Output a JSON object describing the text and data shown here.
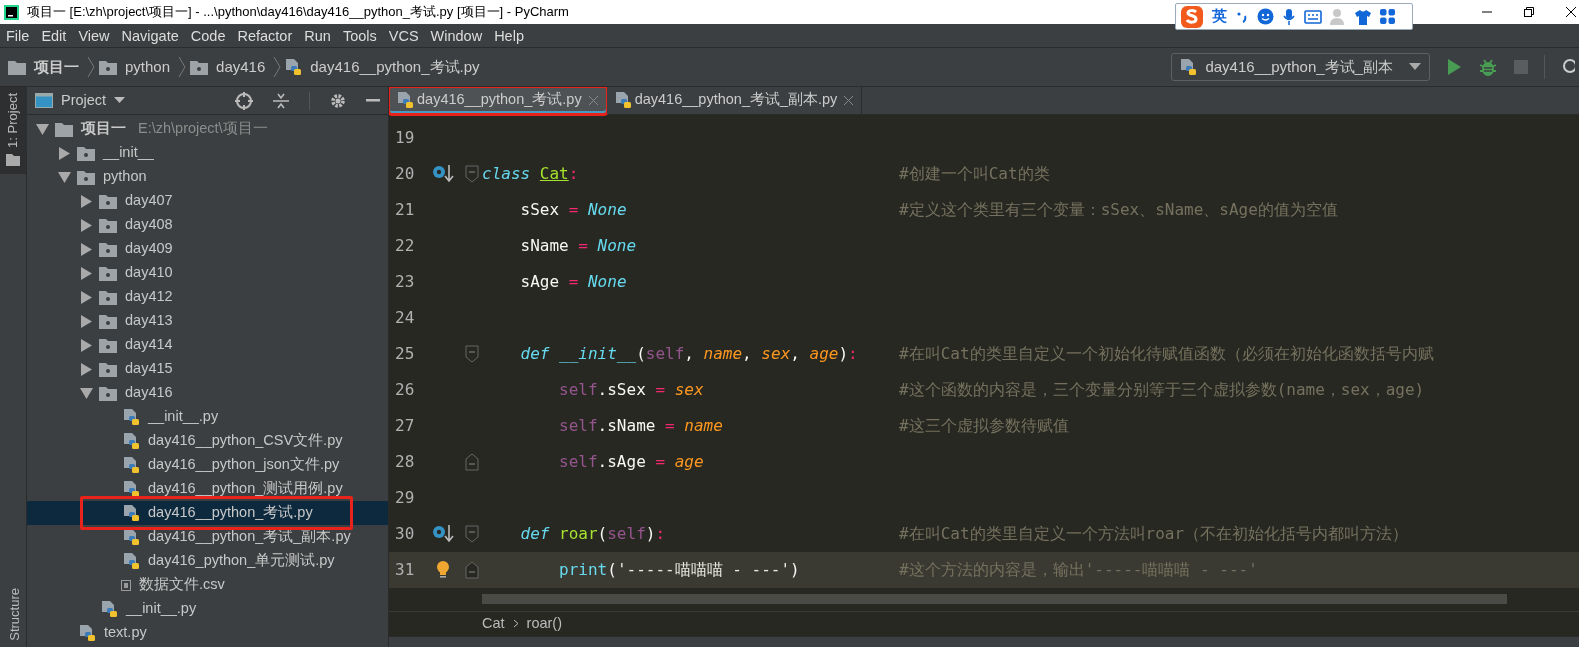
{
  "window": {
    "title": "项目一 [E:\\zh\\project\\项目一] - ...\\python\\day416\\day416__python_考试.py [项目一] - PyCharm"
  },
  "ime_toolbar": {
    "label": "英"
  },
  "menu": [
    "File",
    "Edit",
    "View",
    "Navigate",
    "Code",
    "Refactor",
    "Run",
    "Tools",
    "VCS",
    "Window",
    "Help"
  ],
  "breadcrumb": [
    {
      "label": "项目一",
      "kind": "project"
    },
    {
      "label": "python",
      "kind": "module"
    },
    {
      "label": "day416",
      "kind": "module"
    },
    {
      "label": "day416__python_考试.py",
      "kind": "pyfile"
    }
  ],
  "run_config": {
    "label": "day416__python_考试_副本"
  },
  "tool_windows": [
    {
      "label": "1: Project",
      "selected": true
    },
    {
      "label": "Structure",
      "selected": false
    }
  ],
  "project_panel": {
    "title": "Project"
  },
  "tree": [
    {
      "label": "项目一",
      "path": "E:\\zh\\project\\项目一",
      "kind": "project",
      "expanded": true,
      "selected": false,
      "children": [
        {
          "label": "__init__",
          "kind": "module",
          "expanded": false,
          "selected": false
        },
        {
          "label": "python",
          "kind": "module",
          "expanded": true,
          "selected": false,
          "children": [
            {
              "label": "day407",
              "kind": "module",
              "expanded": false,
              "selected": false
            },
            {
              "label": "day408",
              "kind": "module",
              "expanded": false,
              "selected": false
            },
            {
              "label": "day409",
              "kind": "module",
              "expanded": false,
              "selected": false
            },
            {
              "label": "day410",
              "kind": "module",
              "expanded": false,
              "selected": false
            },
            {
              "label": "day412",
              "kind": "module",
              "expanded": false,
              "selected": false
            },
            {
              "label": "day413",
              "kind": "module",
              "expanded": false,
              "selected": false
            },
            {
              "label": "day414",
              "kind": "module",
              "expanded": false,
              "selected": false
            },
            {
              "label": "day415",
              "kind": "module",
              "expanded": false,
              "selected": false
            },
            {
              "label": "day416",
              "kind": "module",
              "expanded": true,
              "selected": false,
              "children": [
                {
                  "label": "__init__.py",
                  "kind": "pyfile",
                  "selected": false
                },
                {
                  "label": "day416__python_CSV文件.py",
                  "kind": "pyfile",
                  "selected": false
                },
                {
                  "label": "day416__python_json文件.py",
                  "kind": "pyfile",
                  "selected": false
                },
                {
                  "label": "day416__python_测试用例.py",
                  "kind": "pyfile",
                  "selected": false
                },
                {
                  "label": "day416__python_考试.py",
                  "kind": "pyfile",
                  "selected": true,
                  "marked": true
                },
                {
                  "label": "day416__python_考试_副本.py",
                  "kind": "pyfile",
                  "selected": false
                },
                {
                  "label": "day416_python_单元测试.py",
                  "kind": "pyfile",
                  "selected": false
                },
                {
                  "label": "数据文件.csv",
                  "kind": "csv",
                  "selected": false
                }
              ]
            },
            {
              "label": "__init__.py",
              "kind": "pyfile",
              "selected": false
            }
          ]
        },
        {
          "label": "text.py",
          "kind": "pyfile",
          "selected": false
        }
      ]
    }
  ],
  "tabs": [
    {
      "label": "day416__python_考试.py",
      "selected": true,
      "marked": true
    },
    {
      "label": "day416__python_考试_副本.py",
      "selected": false,
      "marked": false
    }
  ],
  "code_lines": [
    {
      "number": "19",
      "current": false
    },
    {
      "number": "20",
      "current": false,
      "gutter_icon": {
        "kind": "override"
      },
      "fold": {
        "kind": "start"
      },
      "tokens": [
        {
          "text": "class ",
          "kind": "keyword"
        },
        {
          "text": "Cat",
          "kind": "classname"
        },
        {
          "text": ":",
          "kind": "operator"
        }
      ],
      "comment": "#创建一个叫Cat的类"
    },
    {
      "number": "21",
      "current": false,
      "tokens": [
        {
          "text": "    sSex ",
          "kind": "plain"
        },
        {
          "text": "=",
          "kind": "operator"
        },
        {
          "text": " None",
          "kind": "constant"
        }
      ],
      "comment": "#定义这个类里有三个变量：sSex、sName、sAge的值为空值"
    },
    {
      "number": "22",
      "current": false,
      "tokens": [
        {
          "text": "    sName ",
          "kind": "plain"
        },
        {
          "text": "=",
          "kind": "operator"
        },
        {
          "text": " None",
          "kind": "constant"
        }
      ]
    },
    {
      "number": "23",
      "current": false,
      "tokens": [
        {
          "text": "    sAge ",
          "kind": "plain"
        },
        {
          "text": "=",
          "kind": "operator"
        },
        {
          "text": " None",
          "kind": "constant"
        }
      ]
    },
    {
      "number": "24",
      "current": false
    },
    {
      "number": "25",
      "current": false,
      "fold": {
        "kind": "start"
      },
      "tokens": [
        {
          "text": "    def ",
          "kind": "keyword"
        },
        {
          "text": "__init__",
          "kind": "special"
        },
        {
          "text": "(",
          "kind": "plain"
        },
        {
          "text": "self",
          "kind": "self"
        },
        {
          "text": ", ",
          "kind": "plain"
        },
        {
          "text": "name",
          "kind": "param"
        },
        {
          "text": ", ",
          "kind": "plain"
        },
        {
          "text": "sex",
          "kind": "param"
        },
        {
          "text": ", ",
          "kind": "plain"
        },
        {
          "text": "age",
          "kind": "param"
        },
        {
          "text": ")",
          "kind": "plain"
        },
        {
          "text": ":",
          "kind": "operator"
        }
      ],
      "comment": "#在叫Cat的类里自定义一个初始化待赋值函数（必须在初始化函数括号内赋"
    },
    {
      "number": "26",
      "current": false,
      "tokens": [
        {
          "text": "        self",
          "kind": "self"
        },
        {
          "text": ".sSex ",
          "kind": "plain"
        },
        {
          "text": "=",
          "kind": "operator"
        },
        {
          "text": " sex",
          "kind": "param"
        }
      ],
      "comment": "#这个函数的内容是，三个变量分别等于三个虚拟参数(name，sex，age)"
    },
    {
      "number": "27",
      "current": false,
      "tokens": [
        {
          "text": "        self",
          "kind": "self"
        },
        {
          "text": ".sName ",
          "kind": "plain"
        },
        {
          "text": "=",
          "kind": "operator"
        },
        {
          "text": " name",
          "kind": "param"
        }
      ],
      "comment": "#这三个虚拟参数待赋值"
    },
    {
      "number": "28",
      "current": false,
      "fold": {
        "kind": "end"
      },
      "tokens": [
        {
          "text": "        self",
          "kind": "self"
        },
        {
          "text": ".sAge ",
          "kind": "plain"
        },
        {
          "text": "=",
          "kind": "operator"
        },
        {
          "text": " age",
          "kind": "param"
        }
      ]
    },
    {
      "number": "29",
      "current": false
    },
    {
      "number": "30",
      "current": false,
      "gutter_icon": {
        "kind": "override"
      },
      "fold": {
        "kind": "start"
      },
      "tokens": [
        {
          "text": "    def ",
          "kind": "keyword"
        },
        {
          "text": "roar",
          "kind": "function"
        },
        {
          "text": "(",
          "kind": "plain"
        },
        {
          "text": "self",
          "kind": "self"
        },
        {
          "text": ")",
          "kind": "plain"
        },
        {
          "text": ":",
          "kind": "operator"
        }
      ],
      "comment": "#在叫Cat的类里自定义一个方法叫roar（不在初始化括号内都叫方法）"
    },
    {
      "number": "31",
      "current": true,
      "gutter_icon": {
        "kind": "bulb"
      },
      "fold": {
        "kind": "end"
      },
      "tokens": [
        {
          "text": "        print",
          "kind": "builtin"
        },
        {
          "text": "(",
          "kind": "plain"
        },
        {
          "text": "'-----喵喵喵 - ---'",
          "kind": "string"
        },
        {
          "text": ")",
          "kind": "plain"
        }
      ],
      "comment": "#这个方法的内容是，输出'-----喵喵喵 - ---'"
    }
  ],
  "editor_breadcrumb": [
    "Cat",
    "roar()"
  ]
}
